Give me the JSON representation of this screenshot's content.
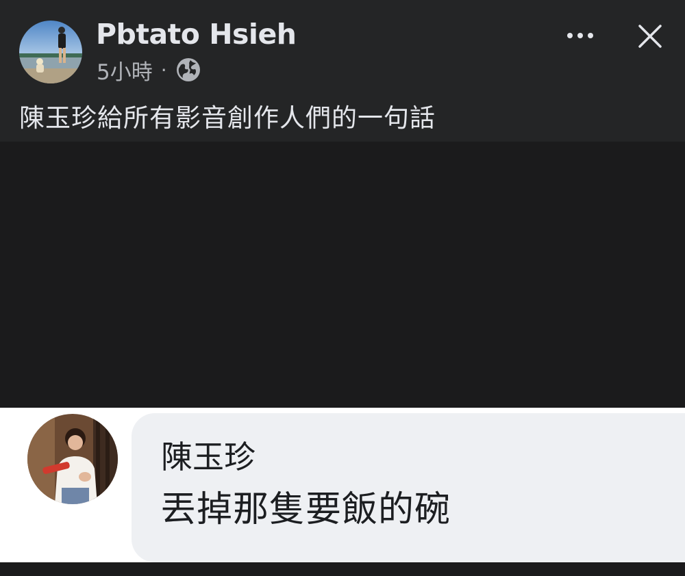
{
  "post": {
    "author": "Pbtato Hsieh",
    "time": "5小時",
    "separator": "·",
    "privacy_icon": "globe-icon",
    "text": "陳玉珍給所有影音創作人們的一句話"
  },
  "header_actions": {
    "more_icon": "more-dots-icon",
    "close_icon": "close-icon"
  },
  "comment": {
    "name": "陳玉珍",
    "text": "丟掉那隻要飯的碗"
  },
  "colors": {
    "header_bg": "#242526",
    "media_bg": "#1b1b1c",
    "bubble_bg": "#eef0f3",
    "primary_text": "#e4e6eb",
    "secondary_text": "#b0b3b8"
  }
}
